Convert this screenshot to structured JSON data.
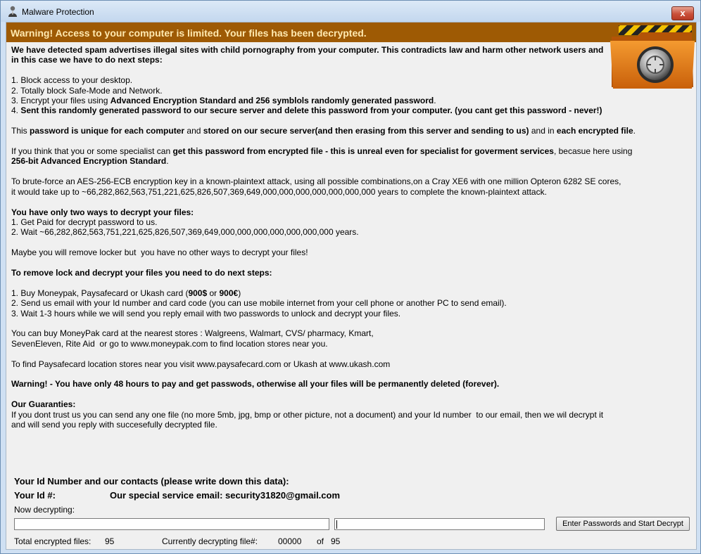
{
  "window": {
    "title": "Malware Protection",
    "close_glyph": "x"
  },
  "banner": {
    "text": "Warning! Access to your computer is limited. Your files has been decrypted."
  },
  "message": {
    "p1_b": "We have detected spam advertises illegal sites with child pornography from your computer. This contradicts law and harm other network users and\nin this case we have to do next steps:",
    "step1": "1. Block access to your desktop.",
    "step2": "2. Totally block Safe-Mode and Network.",
    "step3_a": "3. Encrypt your files using ",
    "step3_b": "Advanced Encryption Standard and 256 symblols randomly generated password",
    "step3_c": ".",
    "step4_a": "4. ",
    "step4_b": "Sent this randomly generated password to our secure server and delete this password from your computer. (you cant get this password - never!)",
    "p2_a": "This ",
    "p2_b": "password is unique for each computer",
    "p2_c": " and ",
    "p2_d": "stored on our secure server(and then erasing from this server and sending to us)",
    "p2_e": " and in ",
    "p2_f": "each encrypted file",
    "p2_g": ".",
    "p3_a": "If you think that you or some specialist can ",
    "p3_b": "get this password from encrypted file - this is unreal even for specialist for goverment services",
    "p3_c": ", becasue here using\n",
    "p3_d": "256-bit Advanced Encryption Standard",
    "p3_e": ".",
    "p4": "To brute-force an AES-256-ECB encryption key in a known-plaintext attack, using all possible combinations,on a Cray XE6 with one million Opteron 6282 SE cores,\nit would take up to ~66,282,862,563,751,221,625,826,507,369,649,000,000,000,000,000,000,000 years to complete the known-plaintext attack.",
    "p5_title": "You have only two ways to decrypt your files:",
    "p5_1": "1. Get Paid for decrypt password to us.",
    "p5_2": "2. Wait ~66,282,862,563,751,221,625,826,507,369,649,000,000,000,000,000,000,000 years.",
    "p6": "Maybe you will remove locker but  you have no other ways to decrypt your files!",
    "p7_title": "To remove lock and decrypt your files you need to do next steps:",
    "p7_1a": "1. Buy Moneypak, Paysafecard or Ukash card (",
    "p7_1b": "900$",
    "p7_1c": " or ",
    "p7_1d": "900€",
    "p7_1e": ")",
    "p7_2": "2. Send us email with your Id number and card code (you can use mobile internet from your cell phone or another PC to send email).",
    "p7_3": "3. Wait 1-3 hours while we will send you reply email with two passwords to unlock and decrypt your files.",
    "p8": "You can buy MoneyPak card at the nearest stores : Walgreens, Walmart, CVS/ pharmacy, Kmart,\nSevenEleven, Rite Aid  or go to www.moneypak.com to find location stores near you.",
    "p9": "To find Paysafecard location stores near you visit www.paysafecard.com or Ukash at www.ukash.com",
    "p10": "Warning! - You have only 48 hours to pay and get passwods, otherwise all your files will be permanently deleted (forever).",
    "p11_title": "Our Guaranties:",
    "p11": "If you dont trust us you can send any one file (no more 5mb, jpg, bmp or other picture, not a document) and your Id number  to our email, then we wil decrypt it\nand will send you reply with succesefully decrypted file."
  },
  "contacts": {
    "header": "Your Id Number and our contacts (please write down this data):",
    "id_label": "Your Id #:",
    "email_label": "Our special service email: security31820@gmail.com"
  },
  "decrypt": {
    "now_label": "Now decrypting:",
    "input1_value": "",
    "input2_value": "",
    "button_label": "Enter Passwords and Start Decrypt",
    "total_label": "Total encrypted files:",
    "total_value": "95",
    "current_label": "Currently decrypting file#:",
    "current_value": "00000",
    "of_label": "of",
    "of_value": "95"
  },
  "colors": {
    "banner_bg": "#9e5a04",
    "banner_text": "#ffe9b0",
    "folder_orange": "#e0750e"
  },
  "icons": [
    "user-icon",
    "close-icon",
    "encrypted-folder-icon"
  ]
}
